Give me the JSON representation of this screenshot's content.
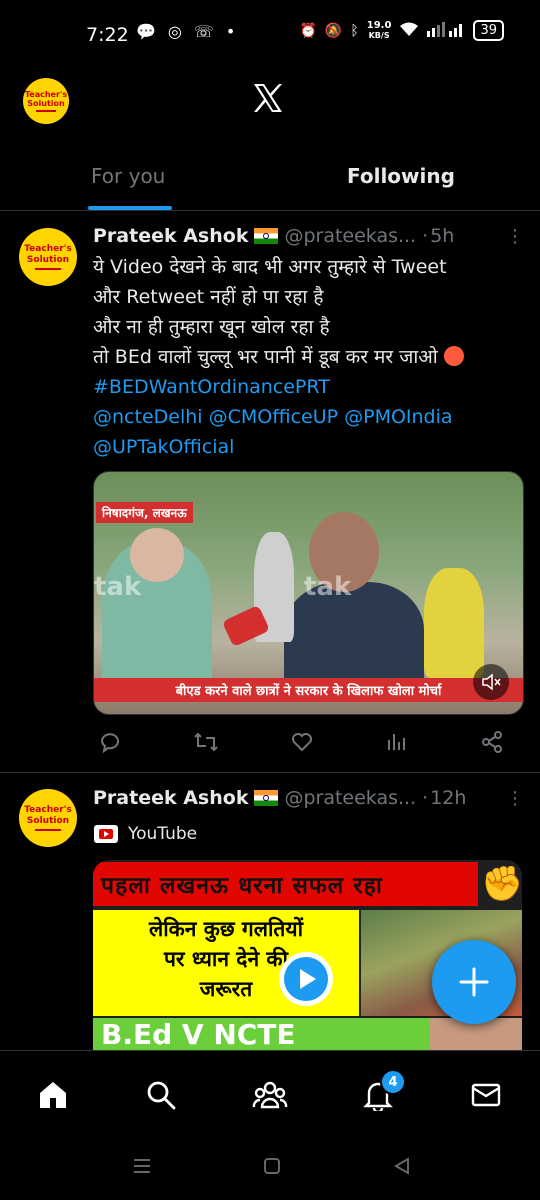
{
  "status_bar": {
    "time": "7:22",
    "net_speed_value": "19.0",
    "net_speed_unit": "KB/S",
    "battery": "39"
  },
  "header": {
    "account_logo_line1": "Teacher's",
    "account_logo_line2": "Solution"
  },
  "tabs": [
    {
      "label": "For you"
    },
    {
      "label": "Following"
    }
  ],
  "tweets": [
    {
      "author": "Prateek Ashok",
      "handle": "@prateekas...",
      "time": "5h",
      "avatar_line1": "Teacher's",
      "avatar_line2": "Solution",
      "text_lines": [
        "ये Video देखने के बाद भी अगर तुम्हारे से Tweet",
        "और Retweet नहीं हो पा रहा है",
        "और ना ही तुम्हारा खून खोल रहा है",
        "तो BEd वालों चुल्लू भर पानी में डूब कर मर जाओ"
      ],
      "hashtag": "#BEDWantOrdinancePRT",
      "mentions_line1": "@ncteDelhi @CMOfficeUP @PMOIndia",
      "mentions_line2": "@UPTakOfficial",
      "video": {
        "location_tag": "निषादगंज, लखनऊ",
        "caption": "बीएड करने वाले छात्रों ने सरकार के खिलाफ खोला मोर्चा",
        "watermark": "tak"
      }
    },
    {
      "author": "Prateek Ashok",
      "handle": "@prateekas...",
      "time": "12h",
      "avatar_line1": "Teacher's",
      "avatar_line2": "Solution",
      "source": "YouTube",
      "thumb": {
        "headline": "पहला लखनऊ धरना सफल रहा",
        "line1": "लेकिन कुछ गलतियों",
        "line2": "पर ध्यान देने की",
        "line3": "जरूरत",
        "bottom": "B.Ed  V  NCTE"
      }
    }
  ],
  "notifications_badge": "4",
  "icons": {
    "x_logo": "x-logo-icon",
    "home": "home-icon",
    "search": "search-icon",
    "communities": "communities-icon",
    "notifications": "bell-icon",
    "messages": "mail-icon",
    "compose": "plus-icon"
  },
  "colors": {
    "accent": "#1d9bf0",
    "background": "#000000",
    "muted": "#71767b"
  }
}
